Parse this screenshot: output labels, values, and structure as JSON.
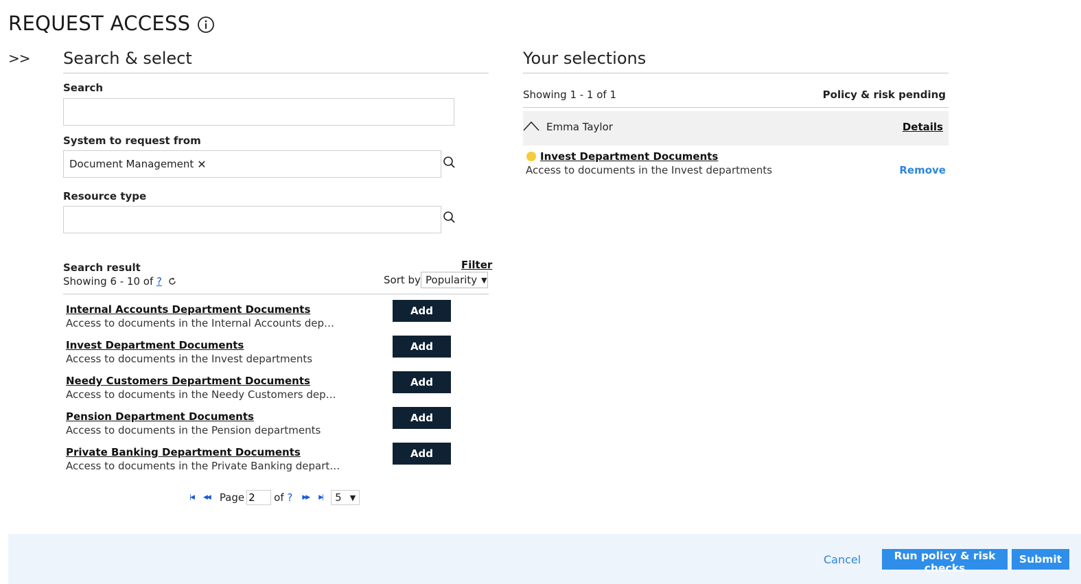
{
  "header": {
    "title": "REQUEST ACCESS",
    "expand_toggle": ">>"
  },
  "left": {
    "section_title": "Search & select",
    "search_label": "Search",
    "search_value": "",
    "search_placeholder": "",
    "system_label": "System to request from",
    "system_chip": "Document Management",
    "system_chip_remove": "✕",
    "resource_label": "Resource type",
    "resource_value": "",
    "results": {
      "title": "Search result",
      "showing_prefix": "Showing 6 - 10 of ",
      "total": "?",
      "filter_label": "Filter",
      "sort_label": "Sort by",
      "sort_value": "Popularity",
      "add_label": "Add",
      "items": [
        {
          "title": "Internal Accounts Department Documents",
          "desc": "Access to documents in the Internal Accounts depart..."
        },
        {
          "title": "Invest Department Documents",
          "desc": "Access to documents in the Invest departments"
        },
        {
          "title": "Needy Customers Department Documents",
          "desc": "Access to documents in the Needy Customers depart..."
        },
        {
          "title": "Pension Department Documents",
          "desc": "Access to documents in the Pension departments"
        },
        {
          "title": "Private Banking Department Documents",
          "desc": "Access to documents in the Private Banking departme..."
        }
      ]
    },
    "pagination": {
      "page_label": "Page",
      "page_value": "2",
      "of_label": "of",
      "total_pages": "?",
      "page_size": "5"
    }
  },
  "right": {
    "section_title": "Your selections",
    "showing": "Showing 1 - 1 of 1",
    "status": "Policy & risk pending",
    "user_name": "Emma Taylor",
    "details_label": "Details",
    "selection": {
      "title": "Invest Department Documents",
      "desc": "Access to documents in the Invest departments",
      "status_color": "#f5cc3a",
      "remove_label": "Remove"
    }
  },
  "footer": {
    "cancel_label": "Cancel",
    "run_label": "Run policy & risk checks",
    "submit_label": "Submit"
  },
  "colors": {
    "accent": "#2e8eea",
    "dark_button": "#0f2233",
    "footer_bg": "#eef4fb"
  }
}
